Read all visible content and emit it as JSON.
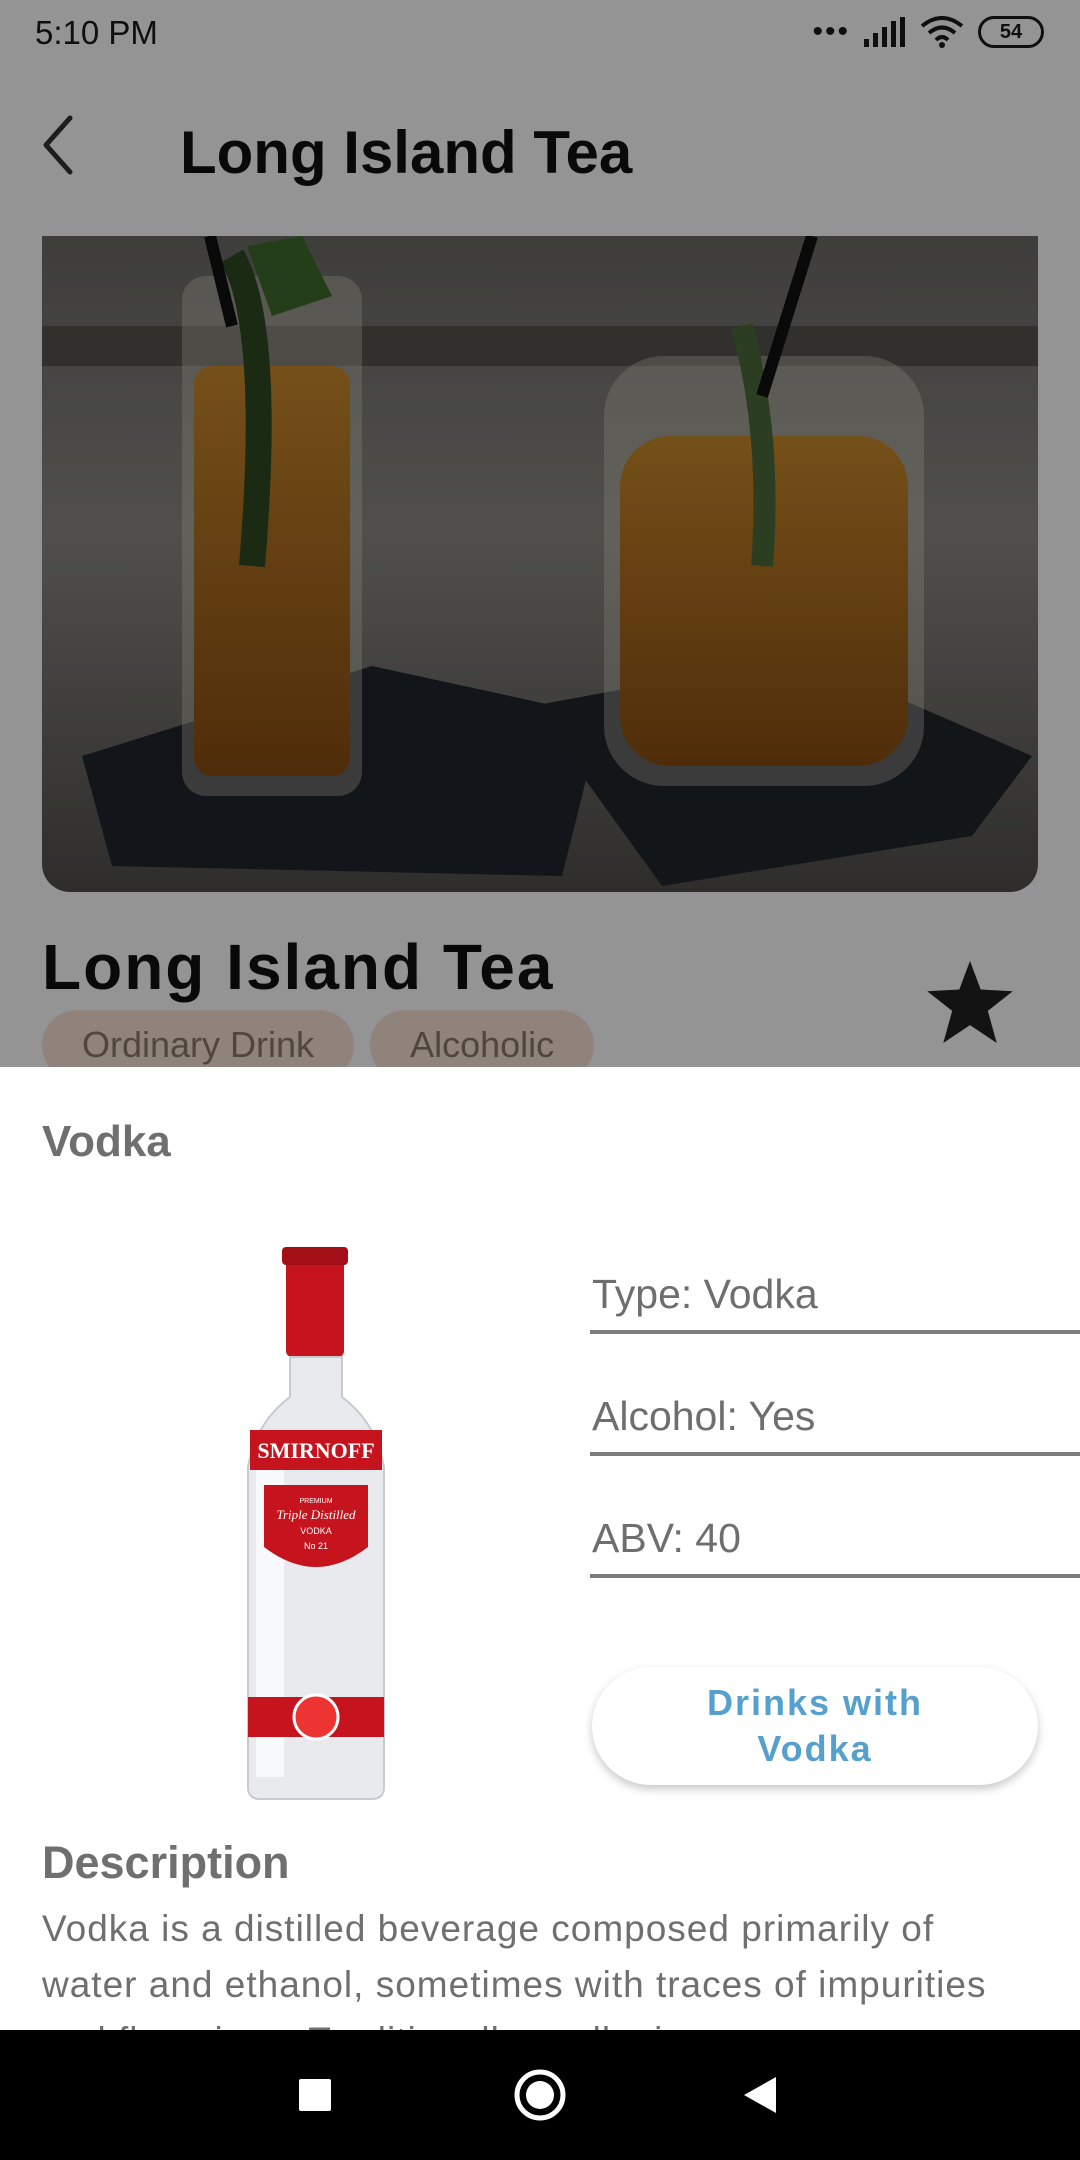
{
  "status_bar": {
    "time": "5:10 PM",
    "signal_dots": "•••",
    "battery": "54"
  },
  "app_bar": {
    "title": "Long Island Tea"
  },
  "drink": {
    "name": "Long Island Tea",
    "chips": [
      "Ordinary Drink",
      "Alcoholic"
    ],
    "favorite_icon": "star-icon"
  },
  "ingredient_sheet": {
    "title": "Vodka",
    "type_field": "Type: Vodka",
    "alcohol_field": "Alcohol: Yes",
    "abv_field": "ABV: 40",
    "drinks_button": "Drinks with Vodka",
    "description_heading": "Description",
    "description_text": "Vodka is a distilled beverage composed primarily of water and ethanol, sometimes with traces of impurities and flavorings. Traditionally, vodka is"
  },
  "bottle_label": {
    "brand": "SMIRNOFF",
    "line1": "PREMIUM",
    "line2": "Triple Distilled",
    "line3": "VODKA",
    "line4": "No 21"
  },
  "colors": {
    "accent_button_text": "#56a0cf",
    "chip_background": "#f6e2d6",
    "scrim": "rgba(0,0,0,0.42)",
    "favorite_star": "#222222"
  },
  "icons": {
    "back": "arrow-back-icon",
    "wifi": "wifi-icon",
    "signal": "signal-icon",
    "battery": "battery-icon",
    "nav_recents": "square-icon",
    "nav_home": "circle-icon",
    "nav_back": "triangle-icon"
  }
}
